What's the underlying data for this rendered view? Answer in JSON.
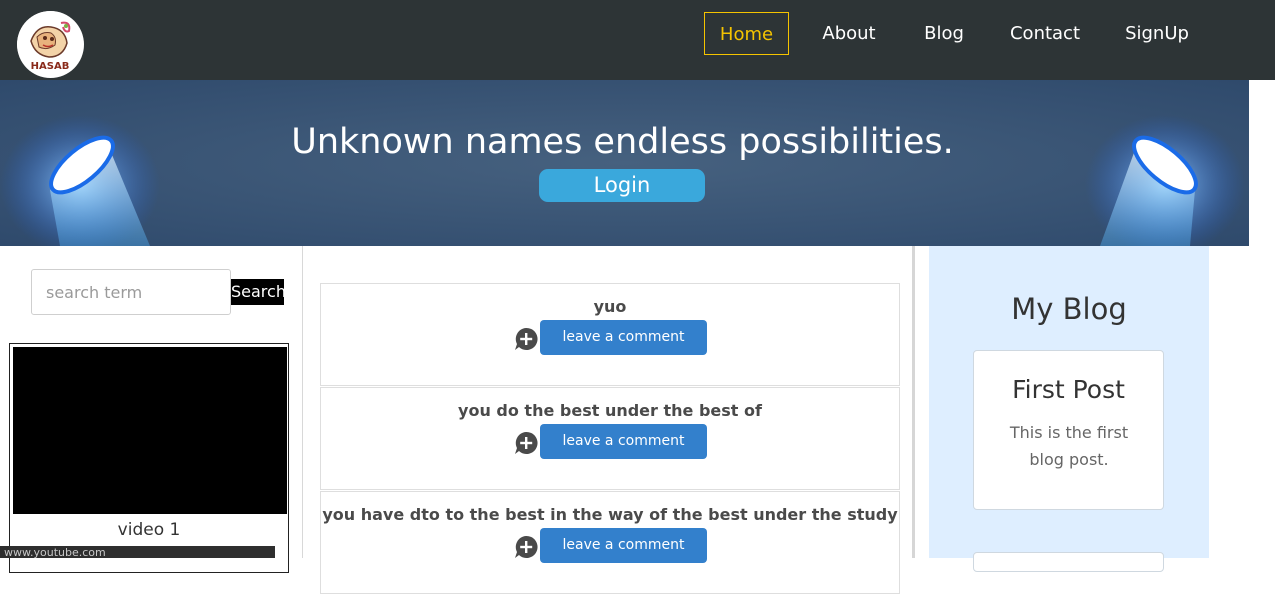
{
  "nav": {
    "items": [
      {
        "label": "Home",
        "active": true
      },
      {
        "label": "About",
        "active": false
      },
      {
        "label": "Blog",
        "active": false
      },
      {
        "label": "Contact",
        "active": false
      },
      {
        "label": "SignUp",
        "active": false
      }
    ],
    "logo_text": "HASAB"
  },
  "hero": {
    "title": "Unknown names endless possibilities.",
    "login_label": "Login"
  },
  "search": {
    "placeholder": "search term",
    "value": "",
    "button_label": "Search"
  },
  "video": {
    "caption": "video 1"
  },
  "status_bar": {
    "url": "www.youtube.com"
  },
  "posts": [
    {
      "text": "yuo",
      "comment_label": "leave a comment"
    },
    {
      "text": "you do the best under the best of",
      "comment_label": "leave a comment"
    },
    {
      "text": "you have dto to the best in the way of the best under the study",
      "comment_label": "leave a comment"
    }
  ],
  "sidebar": {
    "title": "My Blog",
    "cards": [
      {
        "title": "First Post",
        "body": "This is the first blog post."
      }
    ]
  },
  "colors": {
    "navbar_bg": "#2d3436",
    "active_nav": "#f5c400",
    "hero_bg": "#3b5578",
    "login_btn": "#3aa8dc",
    "comment_btn": "#3380cc",
    "sidebar_bg": "#deeeff"
  },
  "icons": [
    "logo-icon",
    "spotlight-left-icon",
    "spotlight-right-icon",
    "comment-add-icon"
  ]
}
